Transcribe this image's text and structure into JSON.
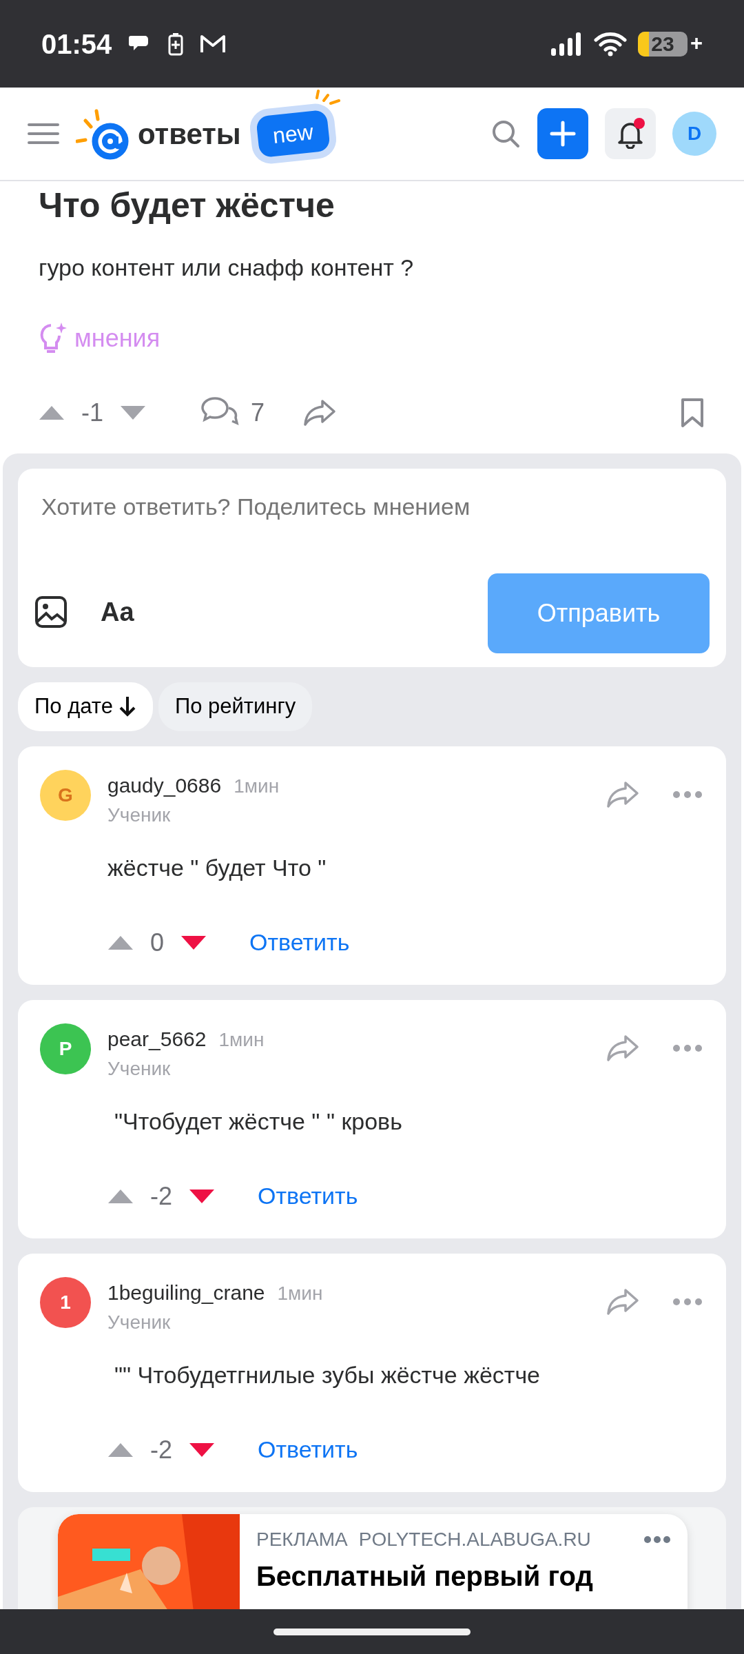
{
  "status_bar": {
    "time": "01:54",
    "battery": "23",
    "charging_sign": "+"
  },
  "header": {
    "logo_text": "ответы",
    "badge": "new",
    "avatar_letter": "D",
    "has_notification": true
  },
  "question": {
    "title": "Что будет жёстче",
    "text": "гуро контент или снафф контент ?",
    "tag": "мнения",
    "rating": "-1",
    "upvoted": false,
    "downvoted": false,
    "comments": "7",
    "bookmarked": false
  },
  "reply_box": {
    "placeholder": "Хотите ответить? Поделитесь мнением",
    "format_label": "Aa",
    "send": "Отправить"
  },
  "sort": [
    {
      "label": "По дате",
      "selected": true
    },
    {
      "label": "По рейтингу",
      "selected": false
    }
  ],
  "answers": [
    {
      "avatar": "G",
      "color": "#ffd35c",
      "author": "gaudy_0686",
      "time": "1мин",
      "rank": "Ученик",
      "text": "жёстче \" будет Что \"",
      "rating": "0",
      "upvoted": false,
      "downvoted": true,
      "reply": "Ответить"
    },
    {
      "avatar": "P",
      "color": "#3cc452",
      "author": "pear_5662",
      "time": "1мин",
      "rank": "Ученик",
      "text": "\"Чтобудет жёстче \" \" кровь",
      "rating": "-2",
      "upvoted": false,
      "downvoted": true,
      "reply": "Ответить"
    },
    {
      "avatar": "1",
      "color": "#f25250",
      "author": "1beguiling_crane",
      "time": "1мин",
      "rank": "Ученик",
      "text": "\"\" Чтобудетгнилые зубы жёстче жёстче",
      "rating": "-2",
      "upvoted": false,
      "downvoted": true,
      "reply": "Ответить"
    }
  ],
  "ad": {
    "label": "РЕКЛАМА",
    "domain": "POLYTECH.ALABUGA.RU",
    "title": "Бесплатный первый год"
  }
}
